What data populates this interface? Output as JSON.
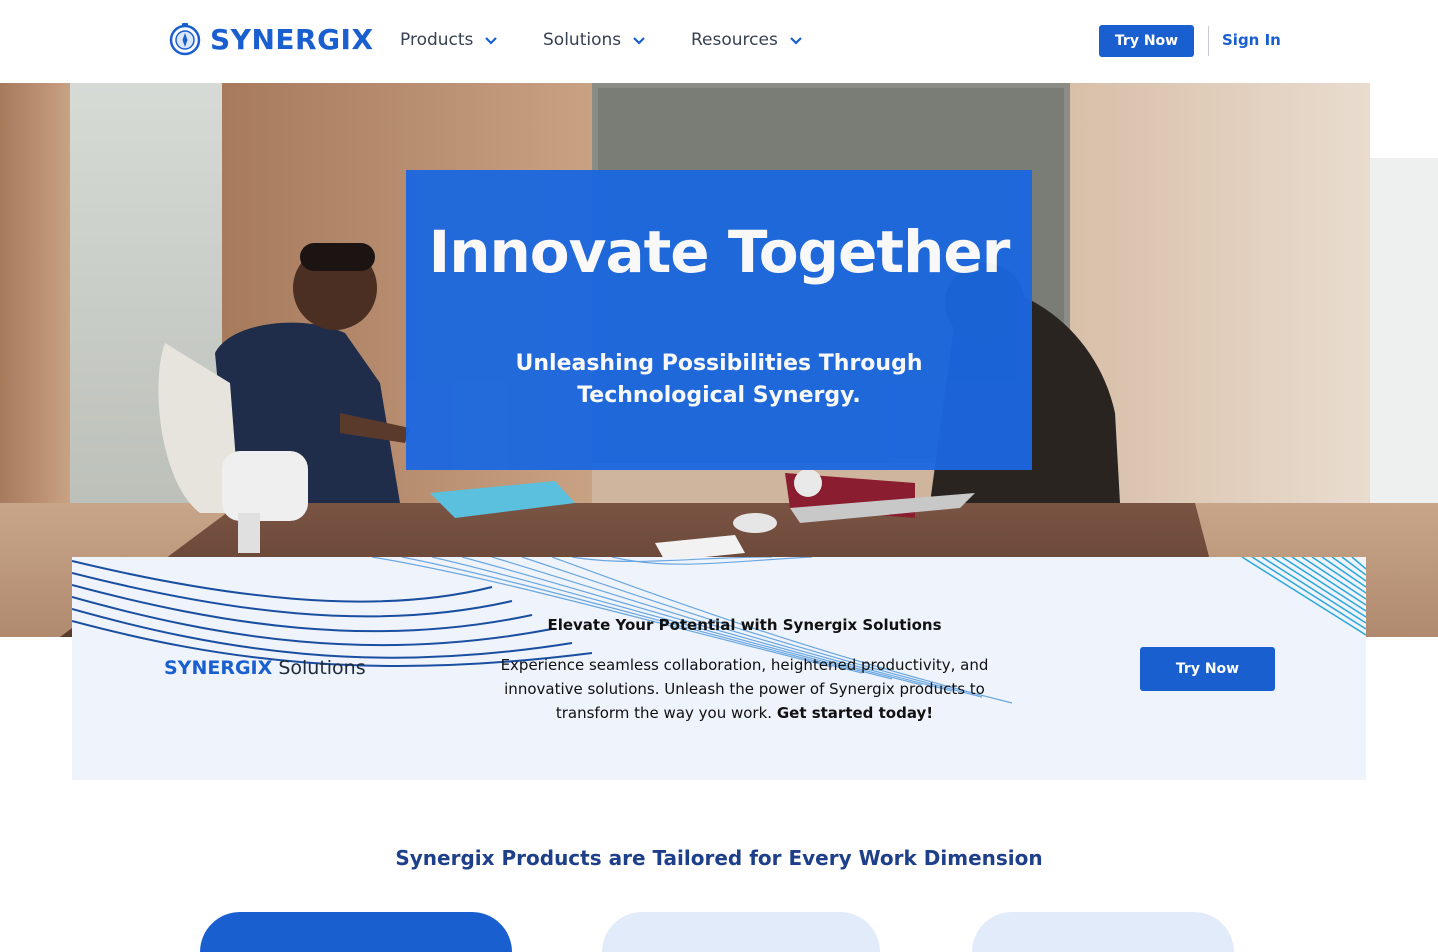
{
  "brand": {
    "name": "SYNERGIX",
    "icon": "compass-icon",
    "color": "#1a5fd0"
  },
  "nav": [
    {
      "label": "Products",
      "icon": "chevron-down-icon"
    },
    {
      "label": "Solutions",
      "icon": "chevron-down-icon"
    },
    {
      "label": "Resources",
      "icon": "chevron-down-icon"
    }
  ],
  "header": {
    "try_now": "Try Now",
    "sign_in": "Sign In"
  },
  "hero": {
    "title": "Innovate Together",
    "subtitle": "Unleashing Possibilities Through Technological Synergy.",
    "box_color": "#1a67e0"
  },
  "solutions_card": {
    "brand_bold": "SYNERGIX",
    "brand_rest": " Solutions",
    "heading": "Elevate Your Potential with Synergix Solutions",
    "body": "Experience seamless collaboration, heightened productivity, and innovative solutions. Unleash the power of Synergix products to transform the way you work. ",
    "body_cta": "Get started today!",
    "button": "Try Now"
  },
  "section": {
    "title": "Synergix Products are Tailored for Every Work Dimension"
  },
  "colors": {
    "accent": "#1a5fd0",
    "card_bg": "#eef3fc",
    "section_title": "#1e3f8a"
  }
}
